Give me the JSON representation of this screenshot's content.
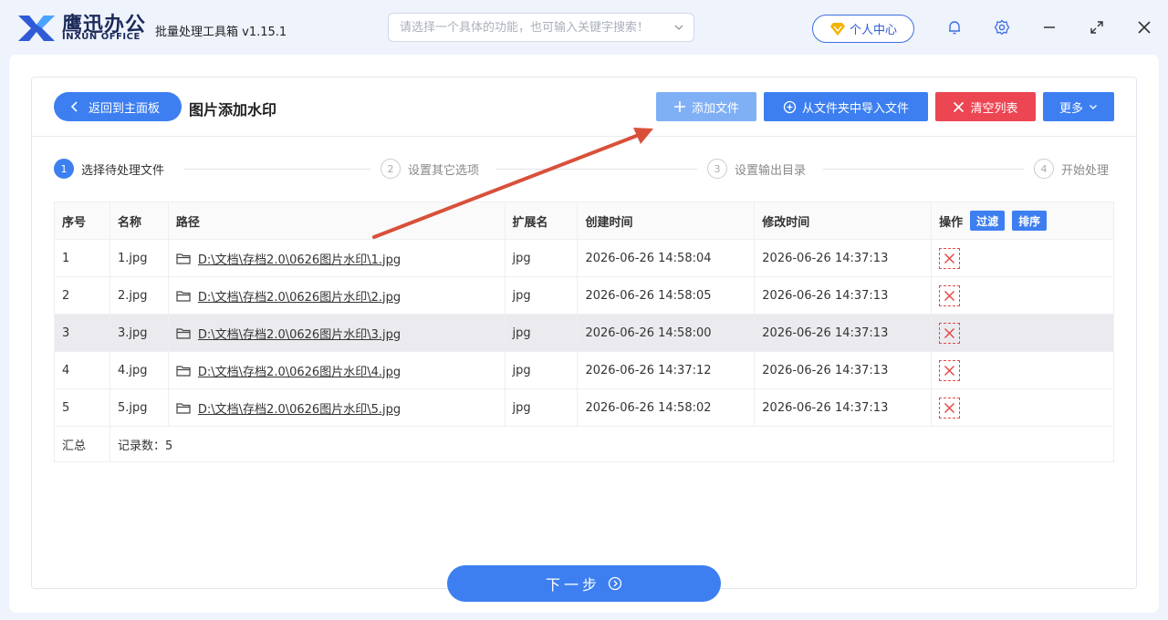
{
  "app": {
    "brand_cn": "鹰迅办公",
    "brand_en": "INXUN OFFICE",
    "title": "批量处理工具箱 v1.15.1"
  },
  "search": {
    "placeholder": "请选择一个具体的功能，也可输入关键字搜索！"
  },
  "user_center": {
    "label": "个人中心"
  },
  "toolbar": {
    "back_label": "返回到主面板",
    "page_title": "图片添加水印",
    "add_file": "添加文件",
    "import_folder": "从文件夹中导入文件",
    "clear_list": "清空列表",
    "more": "更多"
  },
  "steps": [
    {
      "num": "1",
      "label": "选择待处理文件"
    },
    {
      "num": "2",
      "label": "设置其它选项"
    },
    {
      "num": "3",
      "label": "设置输出目录"
    },
    {
      "num": "4",
      "label": "开始处理"
    }
  ],
  "table": {
    "headers": {
      "index": "序号",
      "name": "名称",
      "path": "路径",
      "ext": "扩展名",
      "created": "创建时间",
      "modified": "修改时间",
      "ops": "操作"
    },
    "filter_label": "过滤",
    "sort_label": "排序",
    "rows": [
      {
        "index": "1",
        "name": "1.jpg",
        "path": "D:\\文档\\存档2.0\\0626图片水印\\1.jpg",
        "ext": "jpg",
        "created": "2026-06-26 14:58:04",
        "modified": "2026-06-26 14:37:13"
      },
      {
        "index": "2",
        "name": "2.jpg",
        "path": "D:\\文档\\存档2.0\\0626图片水印\\2.jpg",
        "ext": "jpg",
        "created": "2026-06-26 14:58:05",
        "modified": "2026-06-26 14:37:13"
      },
      {
        "index": "3",
        "name": "3.jpg",
        "path": "D:\\文档\\存档2.0\\0626图片水印\\3.jpg",
        "ext": "jpg",
        "created": "2026-06-26 14:58:00",
        "modified": "2026-06-26 14:37:13"
      },
      {
        "index": "4",
        "name": "4.jpg",
        "path": "D:\\文档\\存档2.0\\0626图片水印\\4.jpg",
        "ext": "jpg",
        "created": "2026-06-26 14:37:12",
        "modified": "2026-06-26 14:37:13"
      },
      {
        "index": "5",
        "name": "5.jpg",
        "path": "D:\\文档\\存档2.0\\0626图片水印\\5.jpg",
        "ext": "jpg",
        "created": "2026-06-26 14:58:02",
        "modified": "2026-06-26 14:37:13"
      }
    ],
    "summary_label": "汇总",
    "summary_value": "记录数：5"
  },
  "next_button": {
    "label": "下一步"
  },
  "icons": [
    "logo-icon",
    "chevron-down-icon",
    "diamond-icon",
    "bell-icon",
    "gear-icon",
    "minimize-icon",
    "maximize-icon",
    "close-icon",
    "chevron-left-icon",
    "plus-icon",
    "folder-import-icon",
    "x-icon",
    "folder-icon",
    "delete-icon",
    "arrow-right-circle-icon"
  ],
  "colors": {
    "primary": "#3d7ff0",
    "danger": "#ec4653",
    "annotation_arrow": "#d9503a"
  }
}
